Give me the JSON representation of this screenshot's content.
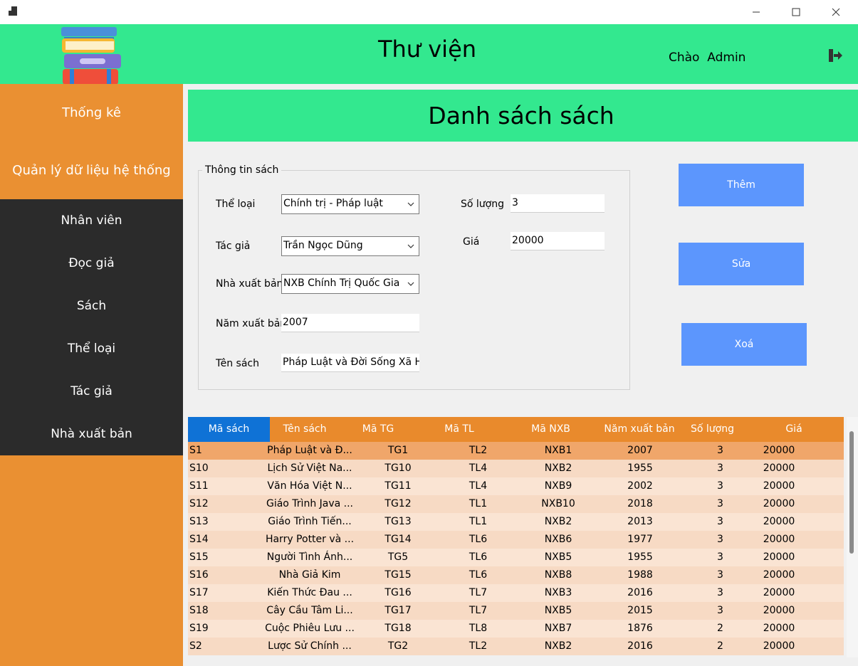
{
  "titlebar": {
    "icons": [
      "app-icon",
      "minimize-icon",
      "maximize-icon",
      "close-icon"
    ]
  },
  "header": {
    "title": "Thư viện",
    "greeting_prefix": "Chào",
    "username": "Admin",
    "logout_icon": "logout-icon",
    "logo_icon": "books-stack-icon",
    "color": "#33e88f"
  },
  "sidebar": {
    "top_items": [
      {
        "label": "Thống kê"
      },
      {
        "label": "Quản lý dữ liệu hệ thống"
      }
    ],
    "sub_items": [
      {
        "label": "Nhân viên"
      },
      {
        "label": "Đọc giả"
      },
      {
        "label": "Sách"
      },
      {
        "label": "Thể loại"
      },
      {
        "label": "Tác giả"
      },
      {
        "label": "Nhà xuất bản"
      }
    ],
    "color": "#ea9032",
    "dark_color": "#2b2b2b"
  },
  "main": {
    "banner_title": "Danh sách sách",
    "form": {
      "group_title": "Thông tin sách",
      "the_loai_label": "Thể loại",
      "the_loai_value": "Chính trị - Pháp luật",
      "tac_gia_label": "Tác giả",
      "tac_gia_value": "Trần Ngọc Dũng",
      "nxb_label": "Nhà xuất bản",
      "nxb_value": "NXB Chính Trị Quốc Gia",
      "nam_label": "Năm xuất bản",
      "nam_value": "2007",
      "ten_label": "Tên sách",
      "ten_value": "Pháp Luật và Đời Sống Xã Hội",
      "so_luong_label": "Số lượng",
      "so_luong_value": "3",
      "gia_label": "Giá",
      "gia_value": "20000"
    },
    "buttons": {
      "add": "Thêm",
      "edit": "Sửa",
      "delete": "Xoá",
      "color": "#5c96fd"
    }
  },
  "table": {
    "headers": [
      "Mã sách",
      "Tên sách",
      "Mã TG",
      "Mã TL",
      "Mã NXB",
      "Năm xuất bản",
      "Số lượng",
      "Giá"
    ],
    "rows": [
      [
        "S1",
        "Pháp Luật và Đ...",
        "TG1",
        "TL2",
        "NXB1",
        "2007",
        "3",
        "20000"
      ],
      [
        "S10",
        "Lịch Sử Việt Na...",
        "TG10",
        "TL4",
        "NXB2",
        "1955",
        "3",
        "20000"
      ],
      [
        "S11",
        "Văn Hóa Việt N...",
        "TG11",
        "TL4",
        "NXB9",
        "2002",
        "3",
        "20000"
      ],
      [
        "S12",
        "Giáo Trình Java ...",
        "TG12",
        "TL1",
        "NXB10",
        "2018",
        "3",
        "20000"
      ],
      [
        "S13",
        "Giáo Trình Tiến...",
        "TG13",
        "TL1",
        "NXB2",
        "2013",
        "3",
        "20000"
      ],
      [
        "S14",
        "Harry Potter và ...",
        "TG14",
        "TL6",
        "NXB6",
        "1977",
        "3",
        "20000"
      ],
      [
        "S15",
        "Người Tình Ánh...",
        "TG5",
        "TL6",
        "NXB5",
        "1955",
        "3",
        "20000"
      ],
      [
        "S16",
        "Nhà Giả Kim",
        "TG15",
        "TL6",
        "NXB8",
        "1988",
        "3",
        "20000"
      ],
      [
        "S17",
        "Kiến Thức Đau ...",
        "TG16",
        "TL7",
        "NXB3",
        "2016",
        "3",
        "20000"
      ],
      [
        "S18",
        "Cây Cầu Tâm Li...",
        "TG17",
        "TL7",
        "NXB5",
        "2015",
        "3",
        "20000"
      ],
      [
        "S19",
        "Cuộc Phiêu Lưu ...",
        "TG18",
        "TL8",
        "NXB7",
        "1876",
        "2",
        "20000"
      ],
      [
        "S2",
        "Lược Sử Chính ...",
        "TG2",
        "TL2",
        "NXB2",
        "2016",
        "2",
        "20000"
      ]
    ],
    "header_color": "#e98a2c",
    "selected_header_color": "#0f72d6",
    "selected_row_color": "#f0a66a",
    "row_color_odd": "#fae4d3",
    "row_color_even": "#f7dac4"
  }
}
